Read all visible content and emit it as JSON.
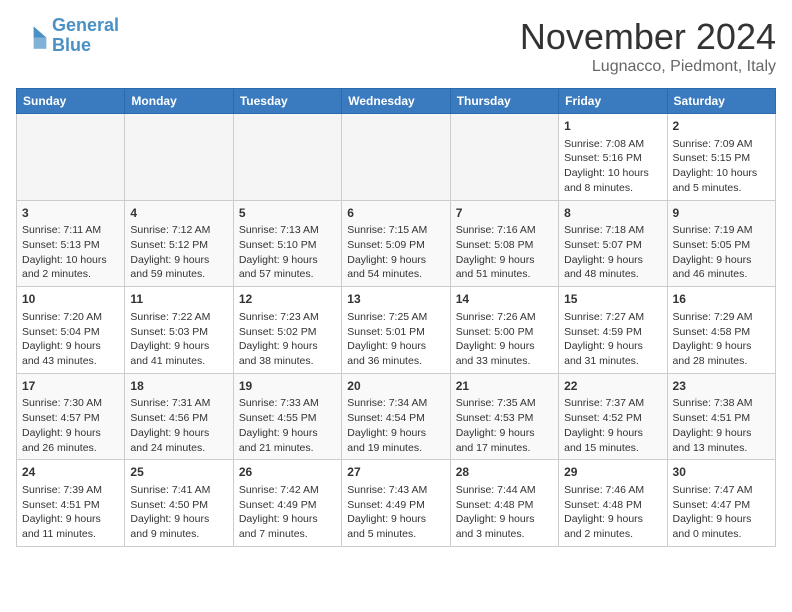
{
  "logo": {
    "line1": "General",
    "line2": "Blue"
  },
  "title": "November 2024",
  "location": "Lugnacco, Piedmont, Italy",
  "weekdays": [
    "Sunday",
    "Monday",
    "Tuesday",
    "Wednesday",
    "Thursday",
    "Friday",
    "Saturday"
  ],
  "weeks": [
    [
      {
        "day": "",
        "info": ""
      },
      {
        "day": "",
        "info": ""
      },
      {
        "day": "",
        "info": ""
      },
      {
        "day": "",
        "info": ""
      },
      {
        "day": "",
        "info": ""
      },
      {
        "day": "1",
        "info": "Sunrise: 7:08 AM\nSunset: 5:16 PM\nDaylight: 10 hours\nand 8 minutes."
      },
      {
        "day": "2",
        "info": "Sunrise: 7:09 AM\nSunset: 5:15 PM\nDaylight: 10 hours\nand 5 minutes."
      }
    ],
    [
      {
        "day": "3",
        "info": "Sunrise: 7:11 AM\nSunset: 5:13 PM\nDaylight: 10 hours\nand 2 minutes."
      },
      {
        "day": "4",
        "info": "Sunrise: 7:12 AM\nSunset: 5:12 PM\nDaylight: 9 hours\nand 59 minutes."
      },
      {
        "day": "5",
        "info": "Sunrise: 7:13 AM\nSunset: 5:10 PM\nDaylight: 9 hours\nand 57 minutes."
      },
      {
        "day": "6",
        "info": "Sunrise: 7:15 AM\nSunset: 5:09 PM\nDaylight: 9 hours\nand 54 minutes."
      },
      {
        "day": "7",
        "info": "Sunrise: 7:16 AM\nSunset: 5:08 PM\nDaylight: 9 hours\nand 51 minutes."
      },
      {
        "day": "8",
        "info": "Sunrise: 7:18 AM\nSunset: 5:07 PM\nDaylight: 9 hours\nand 48 minutes."
      },
      {
        "day": "9",
        "info": "Sunrise: 7:19 AM\nSunset: 5:05 PM\nDaylight: 9 hours\nand 46 minutes."
      }
    ],
    [
      {
        "day": "10",
        "info": "Sunrise: 7:20 AM\nSunset: 5:04 PM\nDaylight: 9 hours\nand 43 minutes."
      },
      {
        "day": "11",
        "info": "Sunrise: 7:22 AM\nSunset: 5:03 PM\nDaylight: 9 hours\nand 41 minutes."
      },
      {
        "day": "12",
        "info": "Sunrise: 7:23 AM\nSunset: 5:02 PM\nDaylight: 9 hours\nand 38 minutes."
      },
      {
        "day": "13",
        "info": "Sunrise: 7:25 AM\nSunset: 5:01 PM\nDaylight: 9 hours\nand 36 minutes."
      },
      {
        "day": "14",
        "info": "Sunrise: 7:26 AM\nSunset: 5:00 PM\nDaylight: 9 hours\nand 33 minutes."
      },
      {
        "day": "15",
        "info": "Sunrise: 7:27 AM\nSunset: 4:59 PM\nDaylight: 9 hours\nand 31 minutes."
      },
      {
        "day": "16",
        "info": "Sunrise: 7:29 AM\nSunset: 4:58 PM\nDaylight: 9 hours\nand 28 minutes."
      }
    ],
    [
      {
        "day": "17",
        "info": "Sunrise: 7:30 AM\nSunset: 4:57 PM\nDaylight: 9 hours\nand 26 minutes."
      },
      {
        "day": "18",
        "info": "Sunrise: 7:31 AM\nSunset: 4:56 PM\nDaylight: 9 hours\nand 24 minutes."
      },
      {
        "day": "19",
        "info": "Sunrise: 7:33 AM\nSunset: 4:55 PM\nDaylight: 9 hours\nand 21 minutes."
      },
      {
        "day": "20",
        "info": "Sunrise: 7:34 AM\nSunset: 4:54 PM\nDaylight: 9 hours\nand 19 minutes."
      },
      {
        "day": "21",
        "info": "Sunrise: 7:35 AM\nSunset: 4:53 PM\nDaylight: 9 hours\nand 17 minutes."
      },
      {
        "day": "22",
        "info": "Sunrise: 7:37 AM\nSunset: 4:52 PM\nDaylight: 9 hours\nand 15 minutes."
      },
      {
        "day": "23",
        "info": "Sunrise: 7:38 AM\nSunset: 4:51 PM\nDaylight: 9 hours\nand 13 minutes."
      }
    ],
    [
      {
        "day": "24",
        "info": "Sunrise: 7:39 AM\nSunset: 4:51 PM\nDaylight: 9 hours\nand 11 minutes."
      },
      {
        "day": "25",
        "info": "Sunrise: 7:41 AM\nSunset: 4:50 PM\nDaylight: 9 hours\nand 9 minutes."
      },
      {
        "day": "26",
        "info": "Sunrise: 7:42 AM\nSunset: 4:49 PM\nDaylight: 9 hours\nand 7 minutes."
      },
      {
        "day": "27",
        "info": "Sunrise: 7:43 AM\nSunset: 4:49 PM\nDaylight: 9 hours\nand 5 minutes."
      },
      {
        "day": "28",
        "info": "Sunrise: 7:44 AM\nSunset: 4:48 PM\nDaylight: 9 hours\nand 3 minutes."
      },
      {
        "day": "29",
        "info": "Sunrise: 7:46 AM\nSunset: 4:48 PM\nDaylight: 9 hours\nand 2 minutes."
      },
      {
        "day": "30",
        "info": "Sunrise: 7:47 AM\nSunset: 4:47 PM\nDaylight: 9 hours\nand 0 minutes."
      }
    ]
  ]
}
